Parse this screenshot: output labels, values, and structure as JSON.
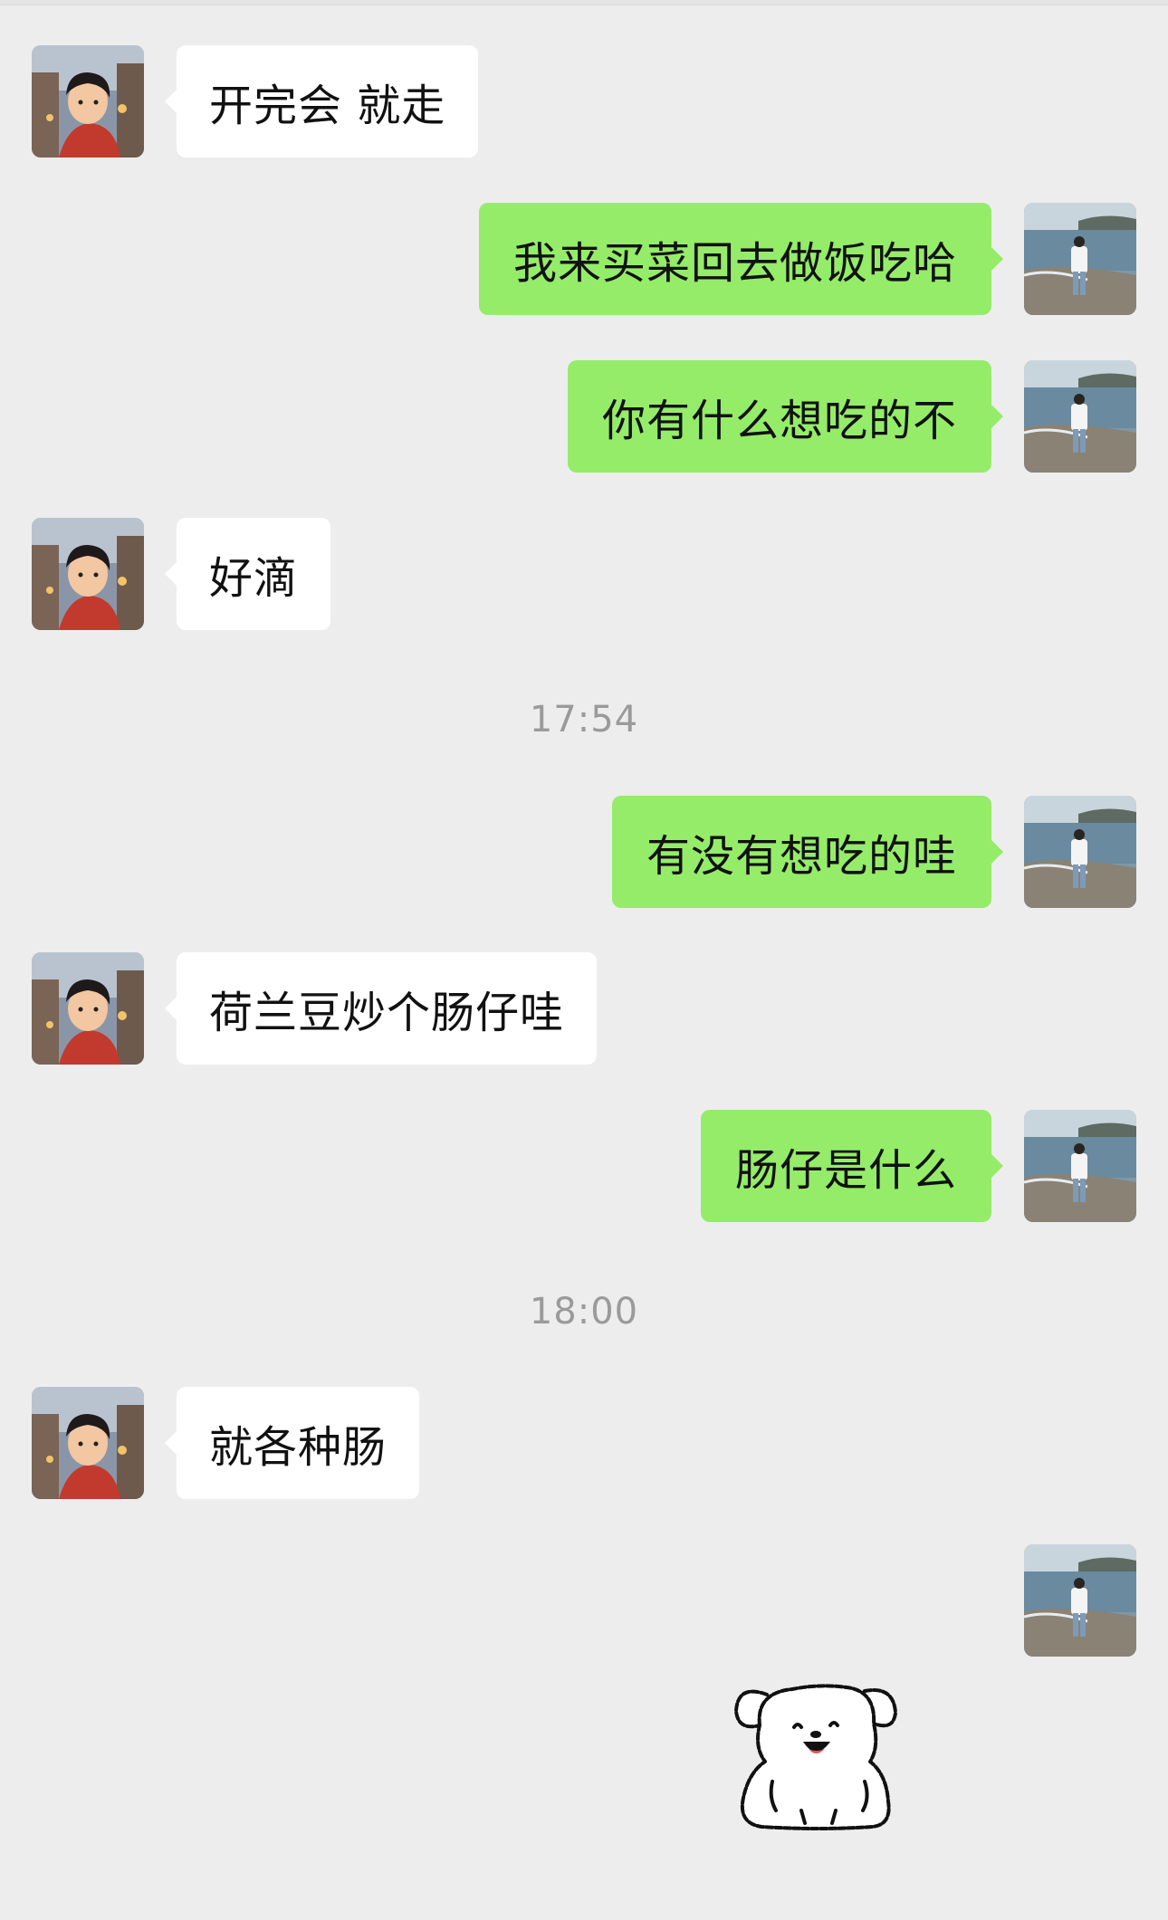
{
  "conversation": {
    "messages": [
      {
        "side": "in",
        "text": "开完会 就走"
      },
      {
        "side": "out",
        "text": "我来买菜回去做饭吃哈"
      },
      {
        "side": "out",
        "text": "你有什么想吃的不"
      },
      {
        "side": "in",
        "text": "好滴"
      },
      {
        "side": "out",
        "text": "有没有想吃的哇"
      },
      {
        "side": "in",
        "text": "荷兰豆炒个肠仔哇"
      },
      {
        "side": "out",
        "text": "肠仔是什么"
      },
      {
        "side": "in",
        "text": "就各种肠"
      },
      {
        "side": "out",
        "type": "sticker",
        "sticker": "white-dog-sticker"
      }
    ],
    "timestamps": [
      "17:54",
      "18:00"
    ]
  },
  "avatars": {
    "contact": "cartoon-boy-avatar",
    "self": "beach-walker-avatar"
  },
  "colors": {
    "background": "#ededed",
    "outgoing_bubble": "#95ec69",
    "incoming_bubble": "#ffffff",
    "timestamp_text": "#9a9a9a"
  }
}
